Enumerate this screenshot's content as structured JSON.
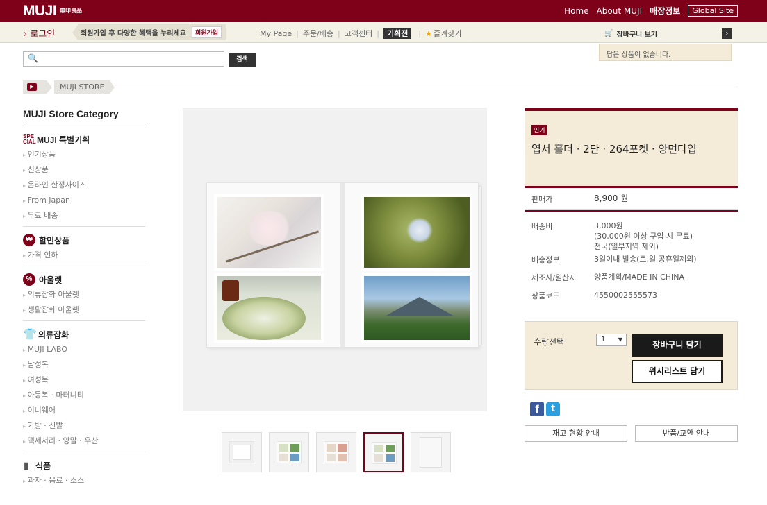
{
  "header": {
    "logo": "MUJI",
    "logo_sub": "無印良品",
    "nav": [
      "Home",
      "About MUJI",
      "매장정보"
    ],
    "global_site": "Global Site"
  },
  "subbar": {
    "login": "› 로그인",
    "promo_text": "회원가입 후 다양한 혜택을 누리세요",
    "promo_button": "회원가입",
    "links": [
      "My Page",
      "주문/배송",
      "고객센터"
    ],
    "plan": "기획전",
    "favorites": "즐겨찾기"
  },
  "cart": {
    "title": "장바구니 보기",
    "empty": "담은 상품이 없습니다."
  },
  "search": {
    "placeholder": "",
    "button": "검색"
  },
  "breadcrumb": {
    "items": [
      "MUJI STORE"
    ]
  },
  "sidebar": {
    "title": "MUJI Store Category",
    "sections": [
      {
        "title": "MUJI 특별기획",
        "icon": "special-icon",
        "items": [
          "인기상품",
          "신상품",
          "온라인 한정사이즈",
          "From Japan",
          "무료 배송"
        ]
      },
      {
        "title": "할인상품",
        "icon": "discount-icon",
        "items": [
          "가격 인하"
        ]
      },
      {
        "title": "아울렛",
        "icon": "percent-icon",
        "items": [
          "의류잡화 아울렛",
          "생활잡화 아울렛"
        ]
      },
      {
        "title": "의류잡화",
        "icon": "shirt-icon",
        "items": [
          "MUJI LABO",
          "남성복",
          "여성복",
          "아동복 · 마터니티",
          "이너웨어",
          "가방 · 신발",
          "액세서리 · 양말 · 우산"
        ]
      },
      {
        "title": "식품",
        "icon": "bottle-icon",
        "items": [
          "과자 · 음료 · 소스"
        ]
      }
    ]
  },
  "product": {
    "badge": "인기",
    "name": "엽서 홀더 · 2단 · 264포켓 · 양면타입",
    "price_label": "판매가",
    "price": "8,900 원",
    "shipping_label": "배송비",
    "shipping_lines": [
      "3,000원",
      "(30,000원 이상 구입 시 무료)",
      "전국(일부지역 제외)"
    ],
    "delivery_label": "배송정보",
    "delivery": "3일이내 발송(토,일 공휴일제외)",
    "maker_label": "제조사/원산지",
    "maker": "양품계획/MADE IN CHINA",
    "code_label": "상품코드",
    "code": "4550002555573"
  },
  "purchase": {
    "qty_label": "수량선택",
    "qty_value": "1",
    "cart_button": "장바구니 담기",
    "wish_button": "위시리스트 담기",
    "stock_button": "재고 현황 안내",
    "return_button": "반품/교환 안내"
  },
  "colors": {
    "brand": "#7f0019",
    "cream": "#f4ecd8"
  }
}
